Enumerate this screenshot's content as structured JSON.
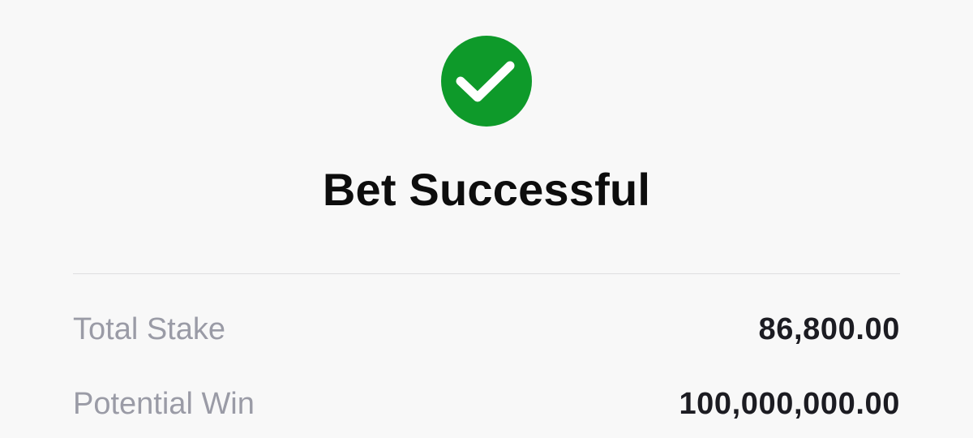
{
  "status": {
    "icon": "checkmark-circle-icon",
    "icon_color": "#0e9a2a",
    "title": "Bet Successful"
  },
  "summary": {
    "rows": [
      {
        "label": "Total Stake",
        "value": "86,800.00"
      },
      {
        "label": "Potential Win",
        "value": "100,000,000.00"
      }
    ]
  }
}
